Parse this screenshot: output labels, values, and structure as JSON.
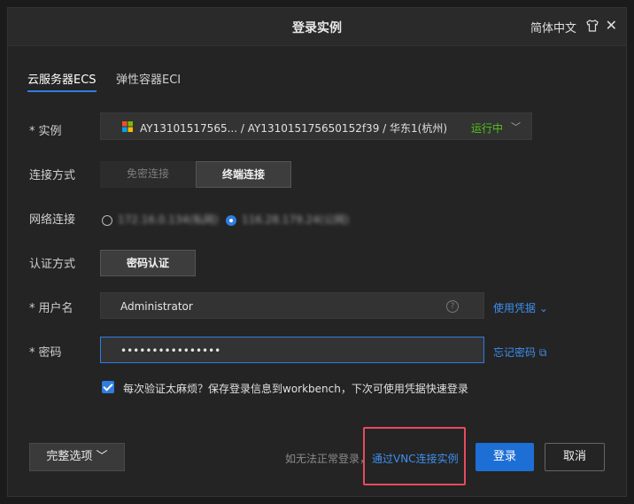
{
  "dialog": {
    "title": "登录实例",
    "language": "简体中文",
    "shirt_icon": "tshirt-icon",
    "close_icon": "close-icon",
    "close_glyph": "✕"
  },
  "tabs": [
    {
      "label": "云服务器ECS",
      "active": true
    },
    {
      "label": "弹性容器ECI",
      "active": false
    }
  ],
  "form": {
    "required_mark": "*",
    "instance": {
      "label": "实例",
      "os_icon": "windows-icon",
      "value": "AY13101517565... / AY131015175650152f39 / 华东1(杭州)",
      "status": "运行中",
      "status_color": "#52c41a",
      "chevron_glyph": "﹀"
    },
    "connection_method": {
      "label": "连接方式",
      "options": [
        "免密连接",
        "终端连接"
      ],
      "selected": "终端连接"
    },
    "network": {
      "label": "网络连接",
      "options": [
        {
          "text": "172.16.0.134(私网)",
          "checked": false
        },
        {
          "text": "116.28.179.24(公网)",
          "checked": true
        }
      ]
    },
    "auth_method": {
      "label": "认证方式",
      "button": "密码认证"
    },
    "username": {
      "label": "用户名",
      "value": "Administrator",
      "help_glyph": "?",
      "link": "使用凭据 ⌄"
    },
    "password": {
      "label": "密码",
      "value": "••••••••••••••••",
      "link": "忘记密码 ⧉"
    },
    "remember": {
      "checked": true,
      "label": "每次验证太麻烦？保存登录信息到workbench，下次可使用凭据快速登录"
    }
  },
  "footer": {
    "more_options": "完整选项 ﹀",
    "hint": "如无法正常登录，",
    "vnc_link": "通过VNC连接实例",
    "login": "登录",
    "cancel": "取消"
  },
  "colors": {
    "accent": "#2f7de1",
    "link": "#3d8ff0",
    "highlight_box": "#e84a5f"
  }
}
